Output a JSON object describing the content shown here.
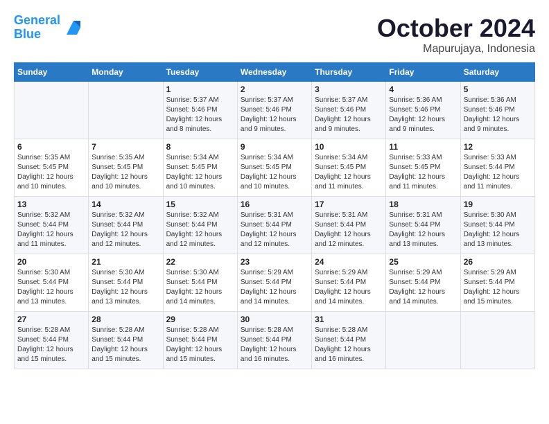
{
  "header": {
    "logo_line1": "General",
    "logo_line2": "Blue",
    "title": "October 2024",
    "subtitle": "Mapurujaya, Indonesia"
  },
  "weekdays": [
    "Sunday",
    "Monday",
    "Tuesday",
    "Wednesday",
    "Thursday",
    "Friday",
    "Saturday"
  ],
  "weeks": [
    [
      {
        "day": "",
        "detail": ""
      },
      {
        "day": "",
        "detail": ""
      },
      {
        "day": "1",
        "detail": "Sunrise: 5:37 AM\nSunset: 5:46 PM\nDaylight: 12 hours\nand 8 minutes."
      },
      {
        "day": "2",
        "detail": "Sunrise: 5:37 AM\nSunset: 5:46 PM\nDaylight: 12 hours\nand 9 minutes."
      },
      {
        "day": "3",
        "detail": "Sunrise: 5:37 AM\nSunset: 5:46 PM\nDaylight: 12 hours\nand 9 minutes."
      },
      {
        "day": "4",
        "detail": "Sunrise: 5:36 AM\nSunset: 5:46 PM\nDaylight: 12 hours\nand 9 minutes."
      },
      {
        "day": "5",
        "detail": "Sunrise: 5:36 AM\nSunset: 5:46 PM\nDaylight: 12 hours\nand 9 minutes."
      }
    ],
    [
      {
        "day": "6",
        "detail": "Sunrise: 5:35 AM\nSunset: 5:45 PM\nDaylight: 12 hours\nand 10 minutes."
      },
      {
        "day": "7",
        "detail": "Sunrise: 5:35 AM\nSunset: 5:45 PM\nDaylight: 12 hours\nand 10 minutes."
      },
      {
        "day": "8",
        "detail": "Sunrise: 5:34 AM\nSunset: 5:45 PM\nDaylight: 12 hours\nand 10 minutes."
      },
      {
        "day": "9",
        "detail": "Sunrise: 5:34 AM\nSunset: 5:45 PM\nDaylight: 12 hours\nand 10 minutes."
      },
      {
        "day": "10",
        "detail": "Sunrise: 5:34 AM\nSunset: 5:45 PM\nDaylight: 12 hours\nand 11 minutes."
      },
      {
        "day": "11",
        "detail": "Sunrise: 5:33 AM\nSunset: 5:45 PM\nDaylight: 12 hours\nand 11 minutes."
      },
      {
        "day": "12",
        "detail": "Sunrise: 5:33 AM\nSunset: 5:44 PM\nDaylight: 12 hours\nand 11 minutes."
      }
    ],
    [
      {
        "day": "13",
        "detail": "Sunrise: 5:32 AM\nSunset: 5:44 PM\nDaylight: 12 hours\nand 11 minutes."
      },
      {
        "day": "14",
        "detail": "Sunrise: 5:32 AM\nSunset: 5:44 PM\nDaylight: 12 hours\nand 12 minutes."
      },
      {
        "day": "15",
        "detail": "Sunrise: 5:32 AM\nSunset: 5:44 PM\nDaylight: 12 hours\nand 12 minutes."
      },
      {
        "day": "16",
        "detail": "Sunrise: 5:31 AM\nSunset: 5:44 PM\nDaylight: 12 hours\nand 12 minutes."
      },
      {
        "day": "17",
        "detail": "Sunrise: 5:31 AM\nSunset: 5:44 PM\nDaylight: 12 hours\nand 12 minutes."
      },
      {
        "day": "18",
        "detail": "Sunrise: 5:31 AM\nSunset: 5:44 PM\nDaylight: 12 hours\nand 13 minutes."
      },
      {
        "day": "19",
        "detail": "Sunrise: 5:30 AM\nSunset: 5:44 PM\nDaylight: 12 hours\nand 13 minutes."
      }
    ],
    [
      {
        "day": "20",
        "detail": "Sunrise: 5:30 AM\nSunset: 5:44 PM\nDaylight: 12 hours\nand 13 minutes."
      },
      {
        "day": "21",
        "detail": "Sunrise: 5:30 AM\nSunset: 5:44 PM\nDaylight: 12 hours\nand 13 minutes."
      },
      {
        "day": "22",
        "detail": "Sunrise: 5:30 AM\nSunset: 5:44 PM\nDaylight: 12 hours\nand 14 minutes."
      },
      {
        "day": "23",
        "detail": "Sunrise: 5:29 AM\nSunset: 5:44 PM\nDaylight: 12 hours\nand 14 minutes."
      },
      {
        "day": "24",
        "detail": "Sunrise: 5:29 AM\nSunset: 5:44 PM\nDaylight: 12 hours\nand 14 minutes."
      },
      {
        "day": "25",
        "detail": "Sunrise: 5:29 AM\nSunset: 5:44 PM\nDaylight: 12 hours\nand 14 minutes."
      },
      {
        "day": "26",
        "detail": "Sunrise: 5:29 AM\nSunset: 5:44 PM\nDaylight: 12 hours\nand 15 minutes."
      }
    ],
    [
      {
        "day": "27",
        "detail": "Sunrise: 5:28 AM\nSunset: 5:44 PM\nDaylight: 12 hours\nand 15 minutes."
      },
      {
        "day": "28",
        "detail": "Sunrise: 5:28 AM\nSunset: 5:44 PM\nDaylight: 12 hours\nand 15 minutes."
      },
      {
        "day": "29",
        "detail": "Sunrise: 5:28 AM\nSunset: 5:44 PM\nDaylight: 12 hours\nand 15 minutes."
      },
      {
        "day": "30",
        "detail": "Sunrise: 5:28 AM\nSunset: 5:44 PM\nDaylight: 12 hours\nand 16 minutes."
      },
      {
        "day": "31",
        "detail": "Sunrise: 5:28 AM\nSunset: 5:44 PM\nDaylight: 12 hours\nand 16 minutes."
      },
      {
        "day": "",
        "detail": ""
      },
      {
        "day": "",
        "detail": ""
      }
    ]
  ]
}
